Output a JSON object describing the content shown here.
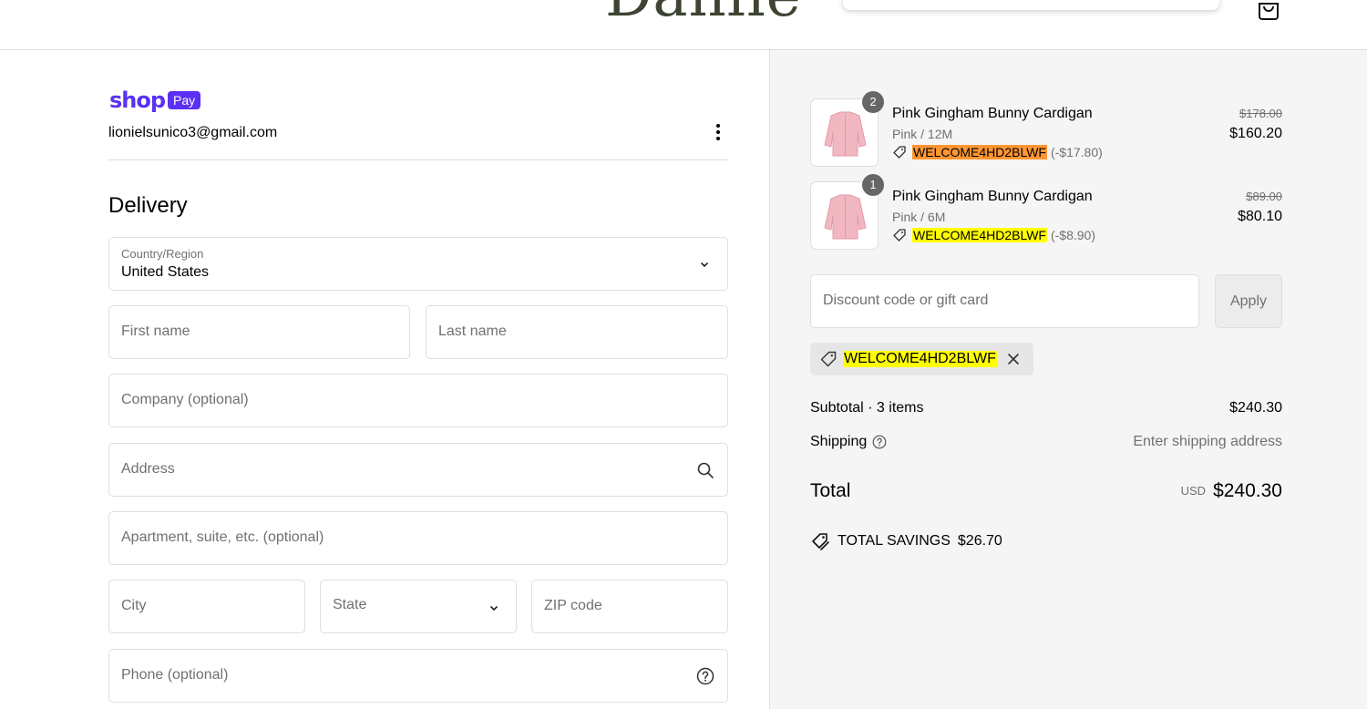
{
  "header": {
    "logo_text": "Dahlie"
  },
  "express": {
    "brand_word": "shop",
    "brand_pill": "Pay",
    "brand_color": "#5a31f4",
    "account_email": "lionielsunico3@gmail.com"
  },
  "delivery": {
    "title": "Delivery",
    "country": {
      "label": "Country/Region",
      "value": "United States"
    },
    "first_name_placeholder": "First name",
    "last_name_placeholder": "Last name",
    "company_placeholder": "Company (optional)",
    "address_placeholder": "Address",
    "apartment_placeholder": "Apartment, suite, etc. (optional)",
    "city_placeholder": "City",
    "state_placeholder": "State",
    "zip_placeholder": "ZIP code",
    "phone_placeholder": "Phone (optional)"
  },
  "summary": {
    "items": [
      {
        "quantity": "2",
        "name": "Pink Gingham Bunny Cardigan",
        "variant": "Pink / 12M",
        "discount_code": "WELCOME4HD2BLWF",
        "discount_amount": "(-$17.80)",
        "original_price": "$178.00",
        "price": "$160.20",
        "highlight_color": "#ff9632"
      },
      {
        "quantity": "1",
        "name": "Pink Gingham Bunny Cardigan",
        "variant": "Pink / 6M",
        "discount_code": "WELCOME4HD2BLWF",
        "discount_amount": "(-$8.90)",
        "original_price": "$89.00",
        "price": "$80.10",
        "highlight_color": "#ffff00"
      }
    ],
    "discount_placeholder": "Discount code or gift card",
    "apply_label": "Apply",
    "applied_code": "WELCOME4HD2BLWF",
    "subtotal_label": "Subtotal · 3 items",
    "subtotal_value": "$240.30",
    "shipping_label": "Shipping",
    "shipping_value": "Enter shipping address",
    "total_label": "Total",
    "total_currency": "USD",
    "total_value": "$240.30",
    "savings_label": "TOTAL SAVINGS",
    "savings_value": "$26.70"
  }
}
